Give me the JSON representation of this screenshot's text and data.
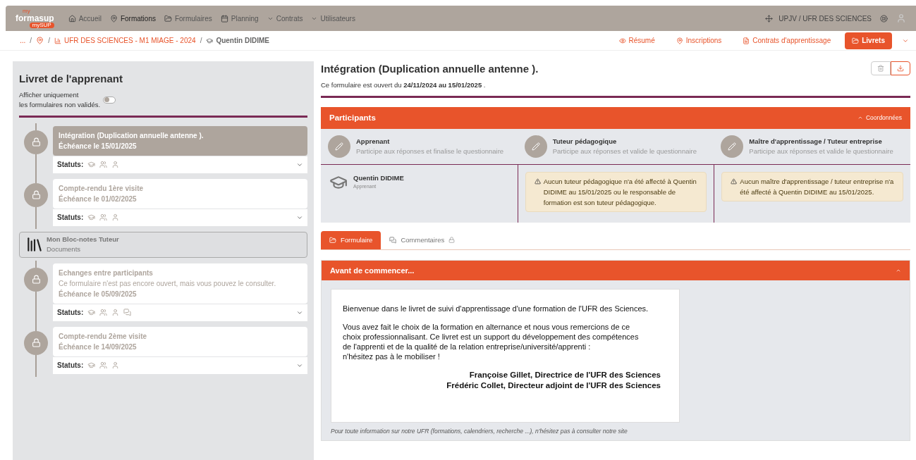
{
  "nav": {
    "logo": {
      "top": "my",
      "main": "formasup",
      "badge": "mySUP"
    },
    "items": [
      {
        "label": "Accueil",
        "kind": "home",
        "selected": false
      },
      {
        "label": "Formations",
        "kind": "formations",
        "selected": true
      },
      {
        "label": "Formulaires",
        "kind": "folder",
        "selected": false
      },
      {
        "label": "Planning",
        "kind": "calendar",
        "selected": false
      },
      {
        "label": "Contrats",
        "kind": "dropdown",
        "selected": false
      },
      {
        "label": "Utilisateurs",
        "kind": "dropdown",
        "selected": false
      }
    ],
    "context": "UPJV / UFR DES SCIENCES"
  },
  "breadcrumb": [
    {
      "kind": "ellipsis",
      "label": "..."
    },
    {
      "kind": "icon",
      "separator": "/"
    },
    {
      "kind": "link",
      "label": "UFR DES SCIENCES - M1 MIAGE - 2024",
      "separator": "/"
    },
    {
      "kind": "current",
      "label": "Quentin DIDIME",
      "separator": "/"
    }
  ],
  "tabs": [
    {
      "label": "Résumé",
      "kind": "eye",
      "selected": false
    },
    {
      "label": "Inscriptions",
      "kind": "inscriptions",
      "selected": false
    },
    {
      "label": "Contrats d'apprentissage",
      "kind": "doc",
      "selected": false
    },
    {
      "label": "Livrets",
      "kind": "folder",
      "selected": true
    }
  ],
  "sidebar": {
    "title": "Livret de l'apprenant",
    "filter_label": "Afficher uniquement\nles formulaires non validés.",
    "filter_on": false,
    "items": [
      {
        "kind": "form",
        "title": "Intégration (Duplication annuelle antenne ).",
        "due": "Échéance le 15/01/2025",
        "statuts_label": "Statuts:",
        "comments_icon": false,
        "selected": true
      },
      {
        "kind": "form",
        "title": "Compte-rendu 1ère visite",
        "due": "Échéance le 01/02/2025",
        "statuts_label": "Statuts:",
        "comments_icon": false,
        "selected": false
      },
      {
        "kind": "notebook",
        "title": "Mon Bloc-notes Tuteur",
        "subtitle": "Documents"
      },
      {
        "kind": "form",
        "title": "Echanges entre participants",
        "note": "Ce formulaire n'est pas encore ouvert, mais vous pouvez le consulter.",
        "due": "Échéance le 05/09/2025",
        "statuts_label": "Statuts:",
        "comments_icon": true,
        "selected": false
      },
      {
        "kind": "form",
        "title": "Compte-rendu 2ème visite",
        "due": "Échéance le 14/09/2025",
        "statuts_label": "Statuts:",
        "comments_icon": false,
        "selected": false
      }
    ]
  },
  "main": {
    "title": "Intégration (Duplication annuelle antenne ).",
    "subtitle": "Ce formulaire est ouvert du **24/11/2024 au 15/01/2025** .",
    "participants": {
      "title": "Participants",
      "toggle": "Coordonnées",
      "roles": [
        {
          "name": "Apprenant",
          "description": "Participe aux réponses et finalise le questionnaire"
        },
        {
          "name": "Tuteur pédagogique",
          "description": "Participe aux réponses et valide le questionnaire"
        },
        {
          "name": "Maître d'apprentissage / Tuteur entreprise",
          "description": "Participe aux réponses et valide le questionnaire"
        }
      ],
      "learner": {
        "name": "Quentin DIDIME",
        "role": "Apprenant"
      },
      "warnings": [
        "Aucun tuteur pédagogique n'a été affecté à Quentin DIDIME au 15/01/2025 ou le responsable de formation est son tuteur pédagogique.",
        "Aucun maître d'apprentissage / tuteur entreprise n'a été affecté à Quentin DIDIME au 15/01/2025."
      ]
    },
    "content_tabs": [
      {
        "label": "Formulaire",
        "kind": "folder",
        "selected": true,
        "locked": false
      },
      {
        "label": "Commentaires",
        "kind": "comments",
        "selected": false,
        "locked": true
      }
    ],
    "section": {
      "title": "Avant de commencer...",
      "paragraphs": [
        "Bienvenue dans le livret de suivi d'apprentissage d'une formation de l'UFR des Sciences.",
        "Vous avez fait le choix de la formation en alternance et nous vous remercions de ce\nchoix professionnalisant. Ce livret est un support du développement des compétences\nde l'apprenti et de la qualité de la relation entreprise/université/apprenti :\nn'hésitez pas à le mobiliser !"
      ],
      "signatures": [
        "Françoise Gillet, Directrice de l'UFR des Sciences",
        "Frédéric Collet, Directeur adjoint de l'UFR des Sciences"
      ],
      "footer": "Pour toute information sur notre UFR (formations, calendriers, recherche ...), n'hésitez pas à consulter notre site"
    }
  }
}
